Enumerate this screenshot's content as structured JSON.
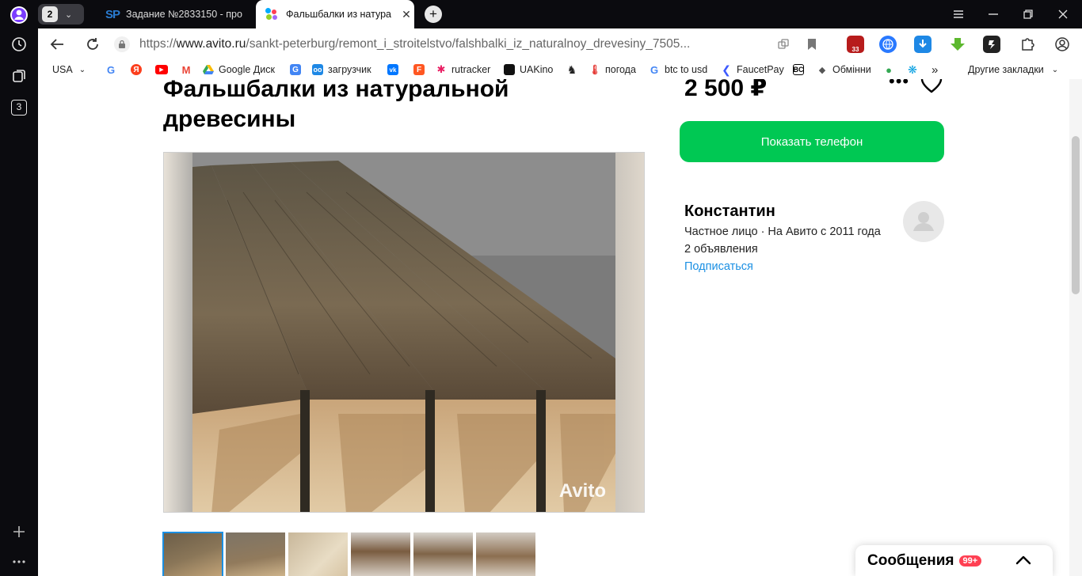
{
  "sidebar": {
    "tabs_count": "3"
  },
  "tabbar": {
    "tabs_badge": "2",
    "tabs": [
      {
        "favicon": "SP",
        "title": "Задание №2833150 - про"
      },
      {
        "title": "Фальшбалки из натура"
      }
    ]
  },
  "address": {
    "url_scheme": "https://",
    "url_host": "www.avito.ru",
    "url_path": "/sankt-peterburg/remont_i_stroitelstvo/falshbalki_iz_naturalnoy_drevesiny_7505..."
  },
  "extensions": {
    "badge": "33"
  },
  "bookmarks": {
    "region": "USA",
    "items": [
      "Google Диск",
      "загрузчик",
      "rutracker",
      "UAKino",
      "погода",
      "btc to usd",
      "FaucetPay",
      "Обмінни"
    ],
    "more": "Другие закладки"
  },
  "listing": {
    "title": "Фальшбалки из натуральной древесины",
    "price": "2 500 ₽",
    "phone_button": "Показать телефон",
    "watermark": "Avito"
  },
  "seller": {
    "name": "Константин",
    "info": "Частное лицо · На Авито с 2011 года",
    "ads": "2 объявления",
    "subscribe": "Подписаться"
  },
  "messages": {
    "label": "Сообщения",
    "badge": "99+"
  },
  "colors": {
    "accent_green": "#00c853",
    "link_blue": "#1a8fe3",
    "badge_red": "#ff4053"
  }
}
